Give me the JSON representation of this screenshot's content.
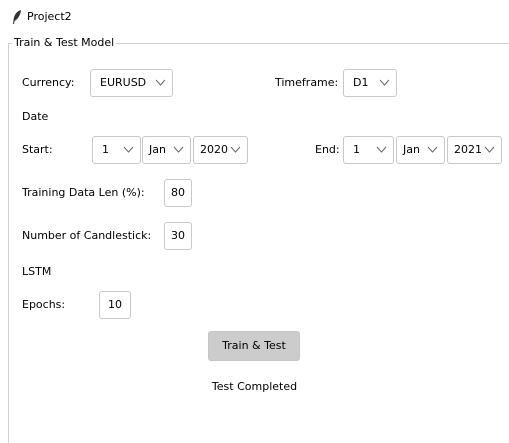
{
  "window": {
    "title": "Project2",
    "icon": "feather-icon"
  },
  "frame": {
    "label": "Train & Test Model"
  },
  "currency": {
    "label": "Currency:",
    "value": "EURUSD"
  },
  "timeframe": {
    "label": "Timeframe:",
    "value": "D1"
  },
  "date": {
    "label": "Date",
    "start": {
      "label": "Start:",
      "day": "1",
      "month": "Jan",
      "year": "2020"
    },
    "end": {
      "label": "End:",
      "day": "1",
      "month": "Jan",
      "year": "2021"
    }
  },
  "training_len": {
    "label": "Training Data Len (%):",
    "value": "80"
  },
  "candlesticks": {
    "label": "Number of Candlestick:",
    "value": "30"
  },
  "lstm": {
    "label": "LSTM"
  },
  "epochs": {
    "label": "Epochs:",
    "value": "10"
  },
  "action": {
    "label": "Train & Test"
  },
  "status": {
    "text": "Test Completed"
  }
}
